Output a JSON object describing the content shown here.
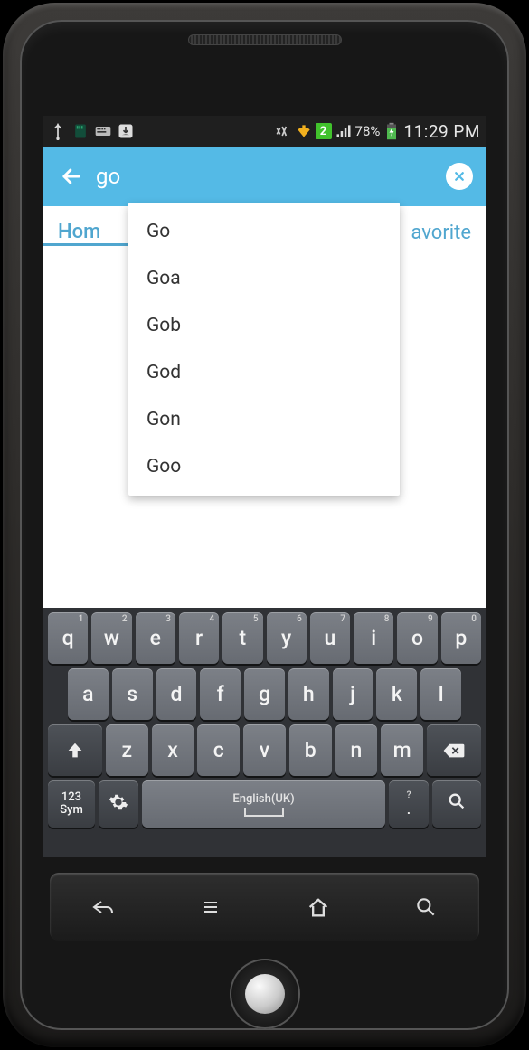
{
  "status": {
    "battery_pct": "78%",
    "time": "11:29 PM",
    "sim_index": "2"
  },
  "search": {
    "query": "go"
  },
  "tabs": {
    "left": "Hom",
    "right": "avorite"
  },
  "suggestions": [
    "Go",
    "Goa",
    "Gob",
    "God",
    "Gon",
    "Goo"
  ],
  "kbd": {
    "row1": [
      {
        "k": "q",
        "h": "1"
      },
      {
        "k": "w",
        "h": "2"
      },
      {
        "k": "e",
        "h": "3"
      },
      {
        "k": "r",
        "h": "4"
      },
      {
        "k": "t",
        "h": "5"
      },
      {
        "k": "y",
        "h": "6"
      },
      {
        "k": "u",
        "h": "7"
      },
      {
        "k": "i",
        "h": "8"
      },
      {
        "k": "o",
        "h": "9"
      },
      {
        "k": "p",
        "h": "0"
      }
    ],
    "row2": [
      "a",
      "s",
      "d",
      "f",
      "g",
      "h",
      "j",
      "k",
      "l"
    ],
    "row3": [
      "z",
      "x",
      "c",
      "v",
      "b",
      "n",
      "m"
    ],
    "sym": "123\nSym",
    "lang": "English(UK)",
    "punct_main": ".",
    "punct_hint": "?"
  }
}
